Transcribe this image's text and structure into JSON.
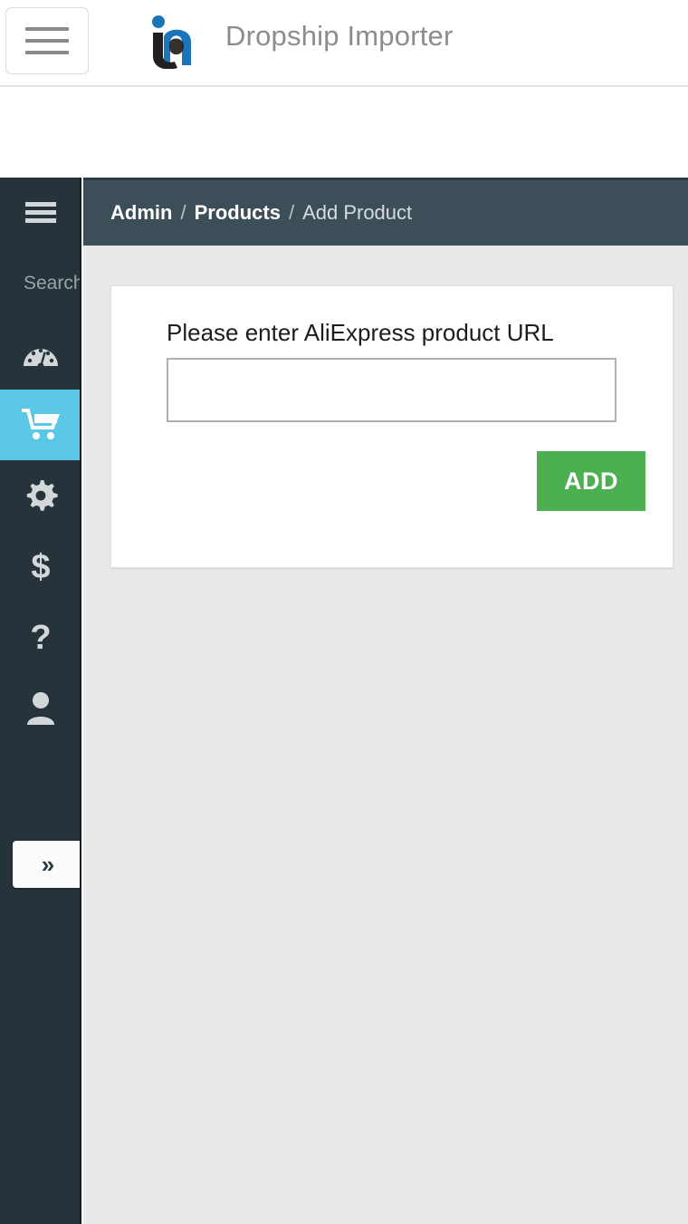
{
  "header": {
    "menu_button": "menu-toggle",
    "logo_alt": "ia",
    "title": "Dropship Importer"
  },
  "sidebar": {
    "menu_icon": "hamburger-icon",
    "search": {
      "placeholder": "Search",
      "value": ""
    },
    "items": [
      {
        "icon": "dashboard-gauge-icon",
        "name": "dashboard",
        "active": false
      },
      {
        "icon": "shopping-cart-icon",
        "name": "products",
        "active": true
      },
      {
        "icon": "gear-icon",
        "name": "settings",
        "active": false
      },
      {
        "icon": "dollar-icon",
        "name": "billing",
        "active": false
      },
      {
        "icon": "question-mark-icon",
        "name": "help",
        "active": false
      },
      {
        "icon": "user-icon",
        "name": "account",
        "active": false
      }
    ],
    "expand_button": "»"
  },
  "breadcrumb": {
    "items": [
      {
        "label": "Admin",
        "current": false
      },
      {
        "label": "Products",
        "current": false
      },
      {
        "label": "Add Product",
        "current": true
      }
    ],
    "separator": "/"
  },
  "card": {
    "heading": "Please enter AliExpress product URL",
    "url_input": {
      "value": "",
      "placeholder": ""
    },
    "add_button": "ADD"
  },
  "colors": {
    "sidebar_bg": "#26333b",
    "sidebar_active": "#5bc8e8",
    "breadcrumb_bg": "#3c4f58",
    "content_bg": "#e9e9e9",
    "add_button": "#4caf50",
    "brand_blue": "#1b75bb",
    "brand_dark": "#231f20"
  }
}
